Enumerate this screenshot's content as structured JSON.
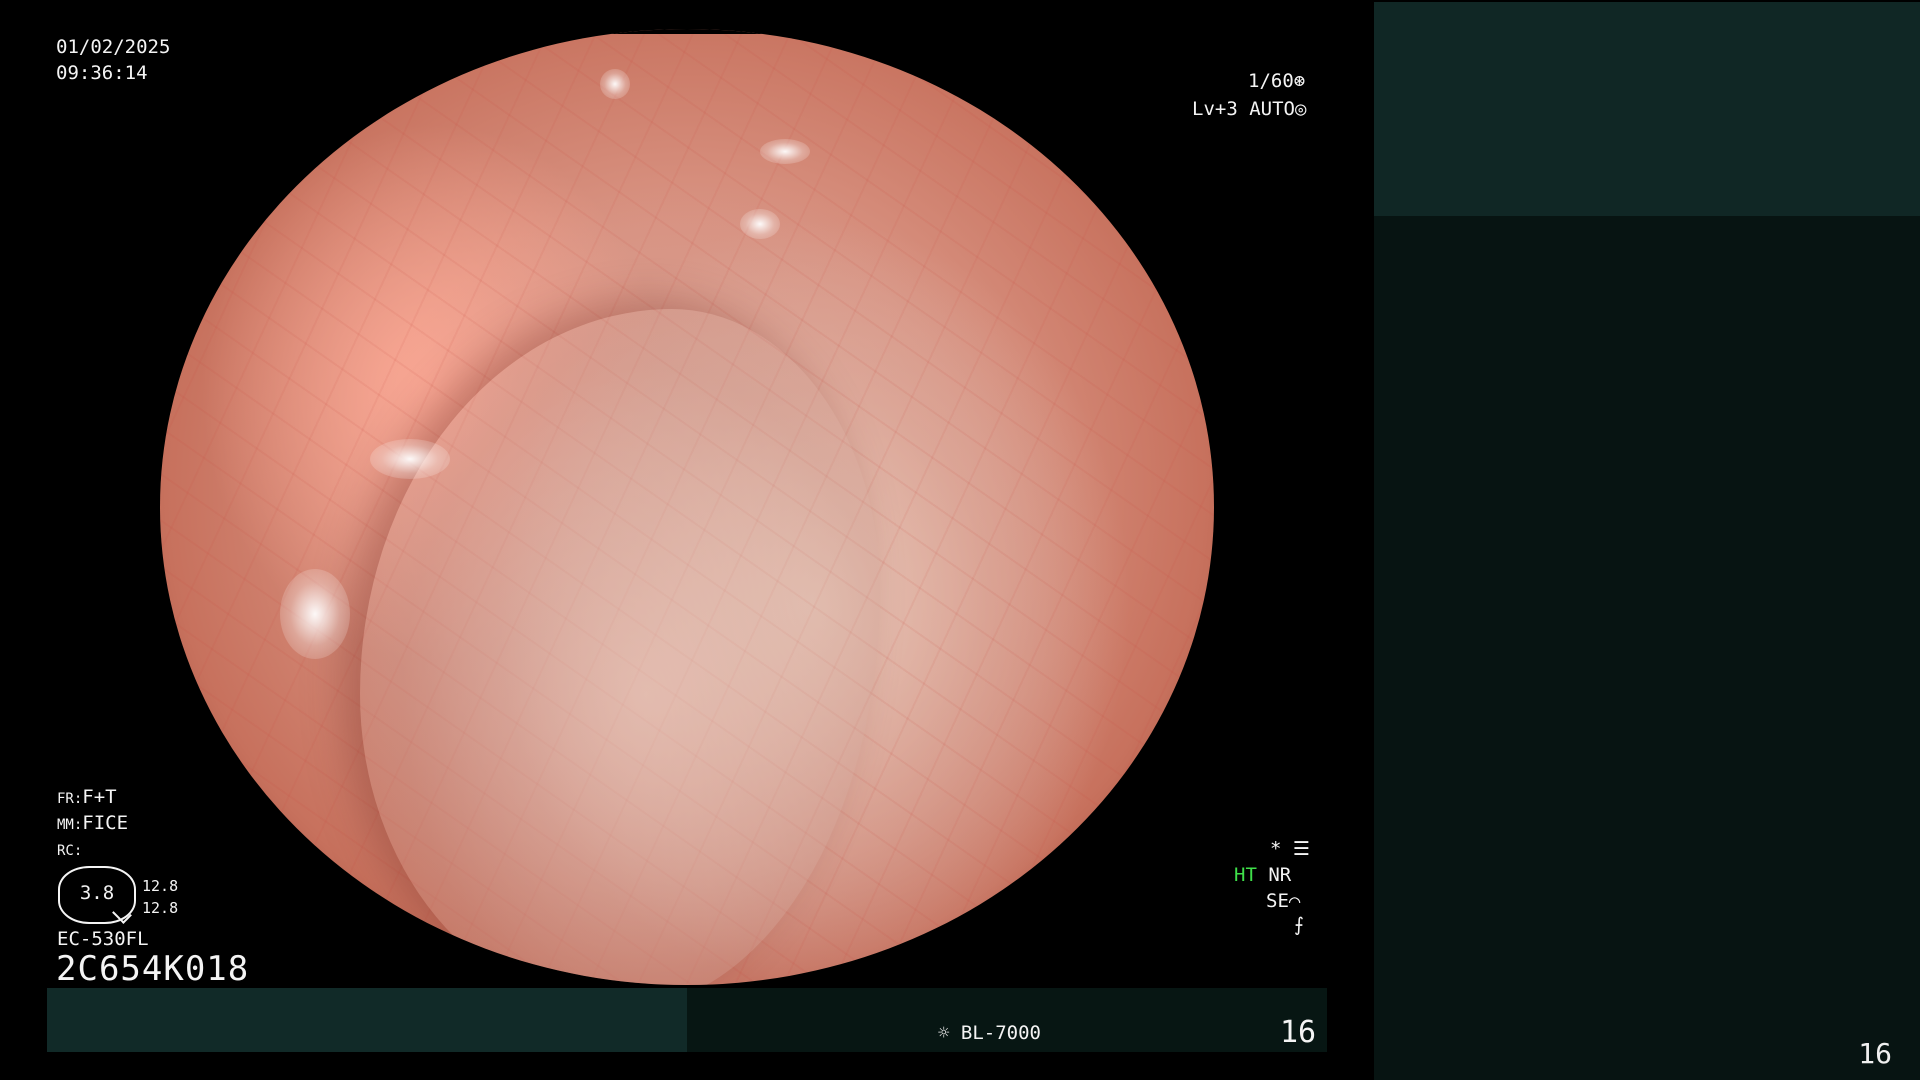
{
  "header": {
    "date": "01/02/2025",
    "time": "09:36:14"
  },
  "settings": {
    "shutter": "1/60",
    "shutter_icon": "aperture-icon",
    "iris_level": "Lv+3",
    "iris_mode": "AUTO",
    "iris_icon": "iris-icon"
  },
  "image_params": {
    "fr_label": "FR:",
    "fr_value": "F+T",
    "mm_label": "MM:",
    "mm_value": "FICE",
    "rc_label": "RC:",
    "zoom_value": "3.8",
    "zoom_a": "12.8",
    "zoom_b": "12.8"
  },
  "scope": {
    "model": "EC-530FL",
    "serial": "2C654K018"
  },
  "status": {
    "star": "*",
    "ht": "HT",
    "nr": "NR",
    "se": "SE",
    "se_icon": "curve-icon",
    "f_icon": "f-stroke-icon"
  },
  "bottom_bar": {
    "light_source": "BL-7000",
    "frame_number": "16"
  },
  "right_panel": {
    "page_number": "16"
  },
  "colors": {
    "ht_green": "#3fe04a",
    "bar_dark": "#071613",
    "bar_teal": "#112a28"
  }
}
